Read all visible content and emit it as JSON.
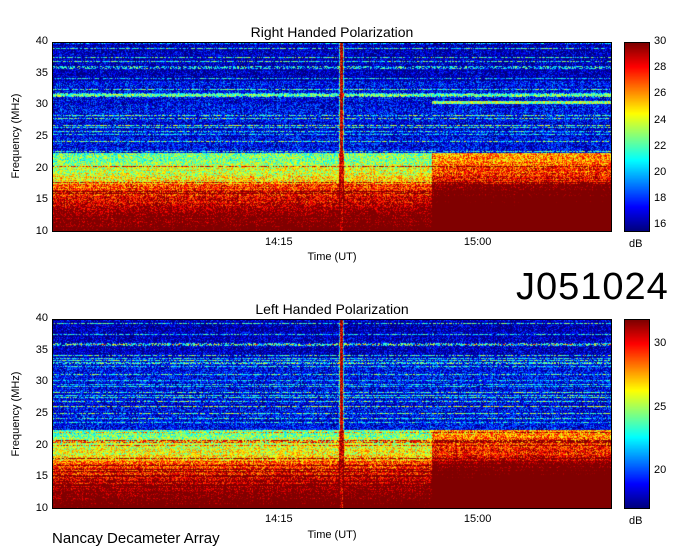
{
  "identifier": "J051024",
  "footer": "Nancay Decameter Array",
  "chart_data": [
    {
      "type": "heatmap",
      "title": "Right Handed Polarization",
      "xlabel": "Time (UT)",
      "ylabel": "Frequency (MHz)",
      "ylim": [
        10,
        40
      ],
      "yticks": [
        "10",
        "15",
        "20",
        "25",
        "30",
        "35",
        "40"
      ],
      "xticks": [
        "14:15",
        "15:00"
      ],
      "colorbar": {
        "min": 15.5,
        "max": 30,
        "ticks": [
          "16",
          "18",
          "20",
          "22",
          "24",
          "26",
          "28",
          "30"
        ],
        "unit": "dB"
      },
      "colormap": "jet"
    },
    {
      "type": "heatmap",
      "title": "Left Handed Polarization",
      "xlabel": "Time (UT)",
      "ylabel": "Frequency (MHz)",
      "ylim": [
        10,
        40
      ],
      "yticks": [
        "10",
        "15",
        "20",
        "25",
        "30",
        "35",
        "40"
      ],
      "xticks": [
        "14:15",
        "15:00"
      ],
      "colorbar": {
        "min": 17,
        "max": 32,
        "ticks": [
          "20",
          "25",
          "30"
        ],
        "unit": "dB"
      },
      "colormap": "jet"
    }
  ]
}
